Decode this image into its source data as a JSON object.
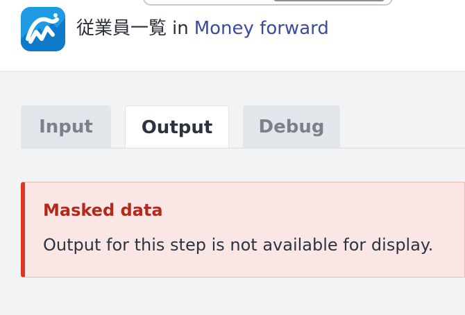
{
  "header": {
    "connector_name": "従業員一覧",
    "connector_in": "in",
    "connector_app": "Money forward",
    "app_icon": "money-forward-logo-icon",
    "colors": {
      "link": "#3b4b9d",
      "logo_bg": "#1f9be3"
    }
  },
  "tabs": [
    {
      "label": "Input",
      "active": false
    },
    {
      "label": "Output",
      "active": true
    },
    {
      "label": "Debug",
      "active": false
    }
  ],
  "alert": {
    "title": "Masked data",
    "message": "Output for this step is not available for display.",
    "colors": {
      "accent": "#d9381e",
      "title": "#b0291b",
      "background": "#fbe6e6"
    }
  }
}
